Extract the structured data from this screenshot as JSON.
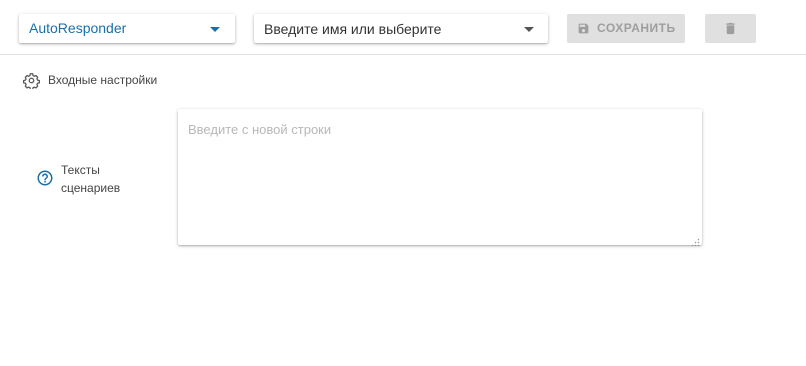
{
  "toolbar": {
    "responder_select": {
      "value": "AutoResponder",
      "text_color": "#1a6fa8",
      "arrow_color": "#1a6fa8",
      "icon": "caret-down-icon"
    },
    "name_select": {
      "placeholder": "Введите имя или выберите",
      "text_color": "#333333",
      "arrow_color": "#555555",
      "icon": "caret-down-icon"
    },
    "save_button": {
      "label": "СОХРАНИТЬ",
      "icon": "floppy-disk-icon",
      "disabled": true,
      "text_color": "#9e9e9e",
      "background": "#e0e0e0"
    },
    "delete_button": {
      "icon": "trash-icon",
      "disabled": true,
      "icon_color": "#9e9e9e",
      "background": "#e0e0e0"
    }
  },
  "section": {
    "icon": "gear-icon",
    "title": "Входные настройки"
  },
  "scenario_texts": {
    "icon": "help-circle-icon",
    "icon_color": "#1a6fa8",
    "label_line1": "Тексты",
    "label_line2": "сценариев",
    "placeholder": "Введите с новой строки"
  }
}
